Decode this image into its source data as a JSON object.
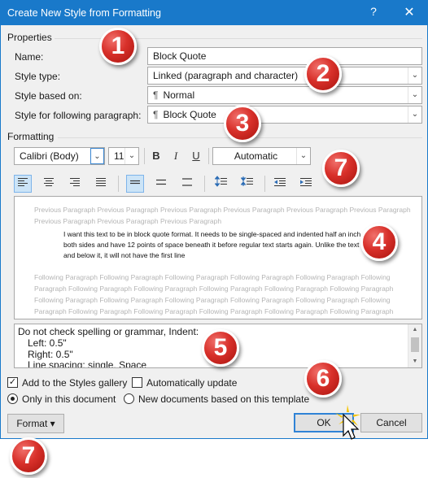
{
  "window": {
    "title": "Create New Style from Formatting",
    "help": "?",
    "close": "✕"
  },
  "properties": {
    "group_label": "Properties",
    "name_label": "Name:",
    "name_value": "Block Quote",
    "style_type_label": "Style type:",
    "style_type_value": "Linked (paragraph and character)",
    "based_on_label": "Style based on:",
    "based_on_value": "Normal",
    "following_label": "Style for following paragraph:",
    "following_value": "Block Quote"
  },
  "formatting": {
    "group_label": "Formatting",
    "font": "Calibri (Body)",
    "size": "11",
    "bold": "B",
    "italic": "I",
    "underline": "U",
    "color": "Automatic"
  },
  "preview": {
    "previous": "Previous Paragraph Previous Paragraph Previous Paragraph Previous Paragraph Previous Paragraph Previous Paragraph Previous Paragraph Previous Paragraph Previous Paragraph",
    "sample": "I want this text to be in block quote format. It needs to be single-spaced and indented half an inch on both sides and have 12 points of space beneath it before regular text starts again. Unlike the text above and below it, it will not have the first line",
    "following": "Following Paragraph Following Paragraph Following Paragraph Following Paragraph Following Paragraph Following Paragraph Following Paragraph Following Paragraph Following Paragraph Following Paragraph Following Paragraph Following Paragraph Following Paragraph Following Paragraph Following Paragraph Following Paragraph Following Paragraph Following Paragraph Following Paragraph Following Paragraph Following Paragraph Following Paragraph"
  },
  "description": {
    "line1": "Do not check spelling or grammar, Indent:",
    "line2": "Left:  0.5\"",
    "line3": "Right:  0.5\"",
    "line4": "Line spacing:  single, Space"
  },
  "options": {
    "add_to_gallery": "Add to the Styles gallery",
    "auto_update": "Automatically update",
    "only_this_doc": "Only in this document",
    "new_docs": "New documents based on this template"
  },
  "buttons": {
    "format": "Format ▾",
    "ok": "OK",
    "cancel": "Cancel"
  },
  "callouts": [
    "1",
    "2",
    "3",
    "4",
    "5",
    "6",
    "7",
    "7"
  ],
  "colors": {
    "titlebar": "#1979ca",
    "badge": "#d8302a",
    "active_button": "#cce4f7"
  }
}
